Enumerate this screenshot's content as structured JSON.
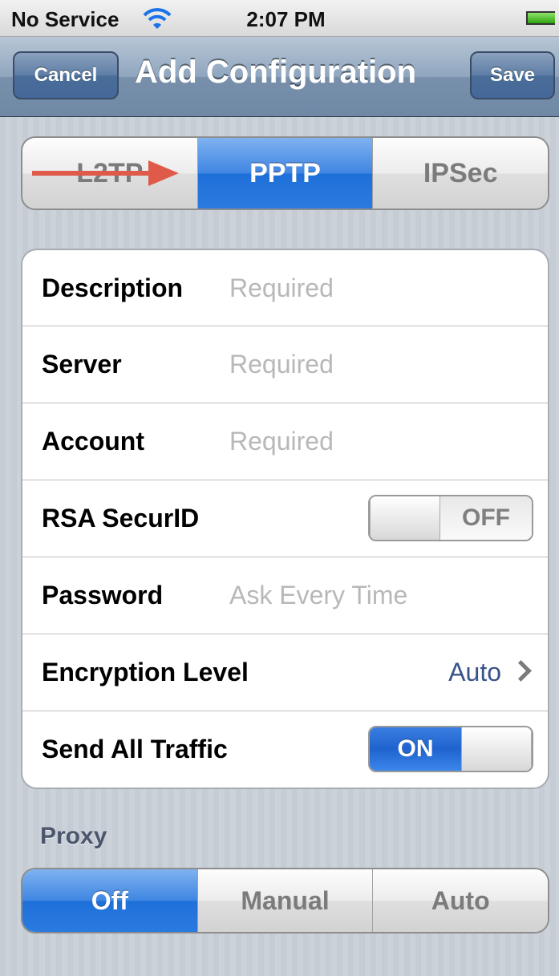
{
  "status_bar": {
    "carrier": "No Service",
    "time": "2:07 PM",
    "wifi_icon": "wifi-icon",
    "battery_icon": "battery-icon"
  },
  "nav": {
    "cancel_label": "Cancel",
    "title": "Add Configuration",
    "save_label": "Save"
  },
  "vpn_types": {
    "options": [
      "L2TP",
      "PPTP",
      "IPSec"
    ],
    "selected": "PPTP"
  },
  "annotation": {
    "arrow_color": "#e05a4a"
  },
  "form": {
    "description": {
      "label": "Description",
      "placeholder": "Required"
    },
    "server": {
      "label": "Server",
      "placeholder": "Required"
    },
    "account": {
      "label": "Account",
      "placeholder": "Required"
    },
    "rsa": {
      "label": "RSA SecurID",
      "state": "OFF"
    },
    "password": {
      "label": "Password",
      "placeholder": "Ask Every Time"
    },
    "encryption": {
      "label": "Encryption Level",
      "value": "Auto"
    },
    "send_all": {
      "label": "Send All Traffic",
      "state": "ON"
    }
  },
  "proxy": {
    "header": "Proxy",
    "options": [
      "Off",
      "Manual",
      "Auto"
    ],
    "selected": "Off"
  },
  "colors": {
    "accent": "#2a7be0",
    "detail_text": "#385487",
    "placeholder_text": "#b8b8b8"
  }
}
